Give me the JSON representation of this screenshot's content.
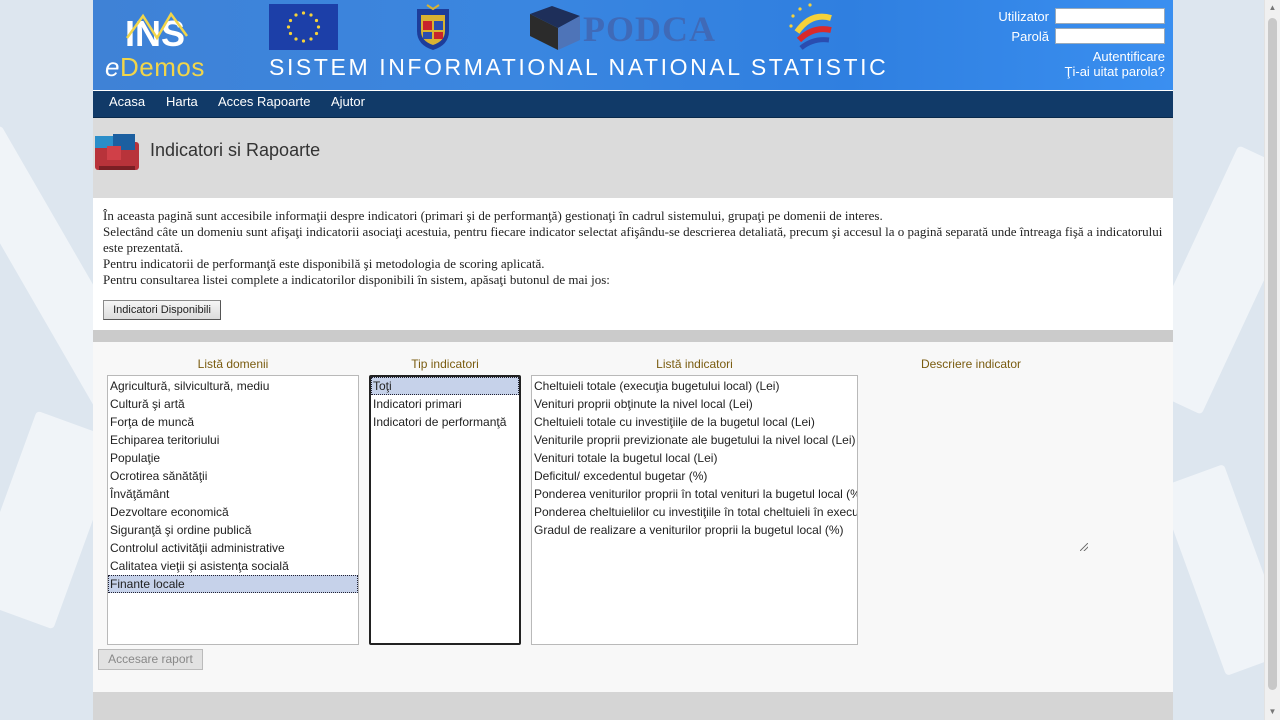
{
  "header": {
    "logo_text": "INS",
    "brand_e": "e",
    "brand_rest": "Demos",
    "podca_text": "PODCA",
    "system_title": "SISTEM INFORMATIONAL NATIONAL STATISTIC",
    "login": {
      "user_label": "Utilizator",
      "password_label": "Parolă",
      "user_value": "",
      "password_value": "",
      "login_link": "Autentificare",
      "forgot_link": "Ţi-ai uitat parola?"
    }
  },
  "nav": {
    "items": [
      {
        "label": "Acasa"
      },
      {
        "label": "Harta"
      },
      {
        "label": "Acces Rapoarte"
      },
      {
        "label": "Ajutor"
      }
    ]
  },
  "page": {
    "title": "Indicatori si Rapoarte",
    "intro": [
      "În aceasta pagină sunt accesibile informaţii despre indicatori (primari şi de performanţă) gestionaţi în cadrul sistemului, grupaţi pe domenii de interes.",
      "Selectând câte un domeniu sunt afişaţi indicatorii asociaţi acestuia, pentru fiecare indicator selectat afişându-se descrierea detaliată, precum şi accesul la o pagină separată unde întreaga fişă a indicatorului este prezentată.",
      "Pentru indicatorii de performanţă este disponibilă şi metodologia de scoring aplicată.",
      "Pentru consultarea listei complete a indicatorilor disponibili în sistem, apăsaţi butonul de mai jos:"
    ],
    "available_button": "Indicatori Disponibili"
  },
  "panel": {
    "domains_header": "Listă domenii",
    "types_header": "Tip indicatori",
    "indicators_header": "Listă indicatori",
    "description_header": "Descriere indicator",
    "domains": [
      {
        "label": "Agricultură, silvicultură, mediu",
        "selected": false
      },
      {
        "label": "Cultură şi artă",
        "selected": false
      },
      {
        "label": "Forţa de muncă",
        "selected": false
      },
      {
        "label": "Echiparea teritoriului",
        "selected": false
      },
      {
        "label": "Populaţie",
        "selected": false
      },
      {
        "label": "Ocrotirea sănătăţii",
        "selected": false
      },
      {
        "label": "Învăţământ",
        "selected": false
      },
      {
        "label": "Dezvoltare economică",
        "selected": false
      },
      {
        "label": "Siguranţă şi ordine publică",
        "selected": false
      },
      {
        "label": "Controlul activităţii administrative",
        "selected": false
      },
      {
        "label": "Calitatea vieţii şi asistenţa socială",
        "selected": false
      },
      {
        "label": "Finante locale",
        "selected": true
      }
    ],
    "types": [
      {
        "label": "Toţi",
        "selected": true
      },
      {
        "label": "Indicatori primari",
        "selected": false
      },
      {
        "label": "Indicatori de performanţă",
        "selected": false
      }
    ],
    "indicators": [
      {
        "label": "Cheltuieli totale (execuţia bugetului local) (Lei)"
      },
      {
        "label": "Venituri proprii obţinute la nivel local (Lei)"
      },
      {
        "label": "Cheltuieli totale cu investiţiile de la bugetul local (Lei)"
      },
      {
        "label": "Veniturile proprii previzionate ale bugetului la nivel local (Lei)"
      },
      {
        "label": "Venituri totale la bugetul local (Lei)"
      },
      {
        "label": "Deficitul/ excedentul bugetar (%)"
      },
      {
        "label": "Ponderea veniturilor proprii în total venituri la bugetul local (%)"
      },
      {
        "label": "Ponderea cheltuielilor cu investiţiile în total cheltuieli în execuţia bugetului local (%)"
      },
      {
        "label": "Gradul de realizare a veniturilor proprii la bugetul local (%)"
      }
    ],
    "report_button": "Accesare raport"
  },
  "colors": {
    "header_blue": "#3a86e0",
    "nav_bg": "#113a68",
    "column_header": "#7a5c10",
    "selection": "#c6d2ea"
  }
}
